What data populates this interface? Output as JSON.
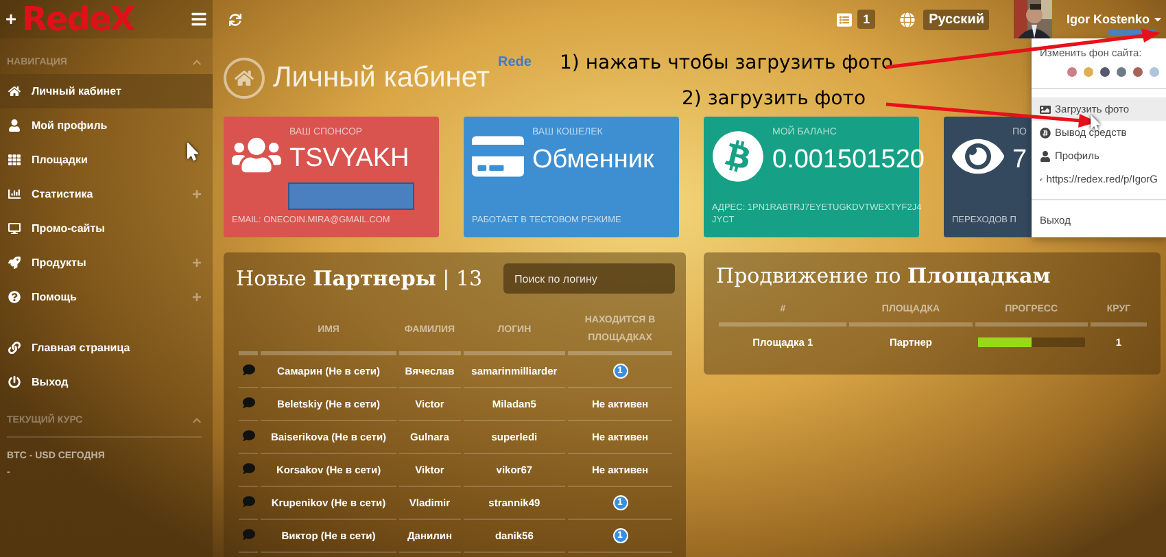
{
  "topbar": {
    "logo": "RedeX",
    "messages_count": "1",
    "language": "Русский",
    "user_name": "Igor Kostenko"
  },
  "sidebar": {
    "nav_header": "НАВИГАЦИЯ",
    "items": [
      {
        "label": "Личный кабинет",
        "plus": false,
        "selected": true
      },
      {
        "label": "Мой профиль",
        "plus": false,
        "selected": false
      },
      {
        "label": "Площадки",
        "plus": false,
        "selected": false
      },
      {
        "label": "Статистика",
        "plus": true,
        "selected": false
      },
      {
        "label": "Промо-сайты",
        "plus": false,
        "selected": false
      },
      {
        "label": "Продукты",
        "plus": true,
        "selected": false
      },
      {
        "label": "Помощь",
        "plus": true,
        "selected": false
      }
    ],
    "bottom_items": [
      {
        "label": "Главная страница",
        "selected": false
      },
      {
        "label": "Выход",
        "selected": false
      }
    ],
    "rate_header": "ТЕКУЩИЙ КУРС",
    "rate_label": "BTC - USD СЕГОДНЯ",
    "rate_value": "-"
  },
  "page_title": "Личный кабинет",
  "header_link": "Rede",
  "annotations": [
    {
      "text": "1) нажать чтобы загрузить фото"
    },
    {
      "text": "2)  загрузить фото"
    }
  ],
  "cards": [
    {
      "kind": "users",
      "color": "#d9534f",
      "label": "ВАШ СПОНСОР",
      "value": "TSVYAKH",
      "footer": "EMAIL: ONECOIN.MIRA@GMAIL.COM"
    },
    {
      "kind": "card",
      "color": "#3d8fd1",
      "label": "ВАШ КОШЕЛЕК",
      "value": "Обменник",
      "footer": "РАБОТАЕТ В ТЕСТОВОМ РЕЖИМЕ"
    },
    {
      "kind": "bitcoin",
      "color": "#16a085",
      "label": "МОЙ БАЛАНС",
      "value": "0.001501520",
      "footer": "АДРЕС: 1PN1RABTRJ7EYETUGKDVTWEXTYF2J4JYCT"
    },
    {
      "kind": "eye",
      "color": "#34495e",
      "label": "ПО",
      "value": "7",
      "footer": "ПЕРЕХОДОВ П"
    }
  ],
  "partners": {
    "title": "Новые **Партнеры** | 13",
    "search_placeholder": "Поиск по логину",
    "columns": [
      "ИМЯ",
      "ФАМИЛИЯ",
      "ЛОГИН",
      "НАХОДИТСЯ В ПЛОЩАДКАХ"
    ],
    "rows": [
      {
        "name": "Самарин (Не в сети)",
        "surname": "Вячеслав",
        "login": "samarinmilliarder",
        "kind": "badge",
        "status": "1"
      },
      {
        "name": "Beletskiy (Не в сети)",
        "surname": "Victor",
        "login": "Miladan5",
        "kind": "text",
        "status": "Не активен"
      },
      {
        "name": "Baiserikova (Не в сети)",
        "surname": "Gulnara",
        "login": "superledi",
        "kind": "text",
        "status": "Не активен"
      },
      {
        "name": "Korsakov (Не в сети)",
        "surname": "Viktor",
        "login": "vikor67",
        "kind": "text",
        "status": "Не активен"
      },
      {
        "name": "Krupenikov (Не в сети)",
        "surname": "Vladimir",
        "login": "strannik49",
        "kind": "badge",
        "status": "1"
      },
      {
        "name": "Виктор (Не в сети)",
        "surname": "Данилин",
        "login": "danik56",
        "kind": "badge",
        "status": "1"
      }
    ]
  },
  "progress": {
    "title": "Продвижение по **Площадкам**",
    "columns": [
      "#",
      "ПЛОЩАДКА",
      "ПРОГРЕСС",
      "КРУГ"
    ],
    "rows": [
      {
        "place": "Площадка 1",
        "role": "Партнер",
        "level": 0.5,
        "round": "1"
      }
    ]
  },
  "dropdown": {
    "bg_label": "Изменить фон сайта:",
    "swatches": [
      {
        "color": "#c98088"
      },
      {
        "color": "#e0b050"
      },
      {
        "color": "#55586e"
      },
      {
        "color": "#6c7c88"
      },
      {
        "color": "#a5645a"
      },
      {
        "color": "#aec4da"
      }
    ],
    "items": [
      {
        "label": "Загрузить фото",
        "selected": true
      },
      {
        "label": "Вывод средств",
        "selected": false
      },
      {
        "label": "Профиль",
        "selected": false
      },
      {
        "label": "https://redex.red/p/IgorG",
        "selected": false
      }
    ],
    "logout": "Выход"
  }
}
